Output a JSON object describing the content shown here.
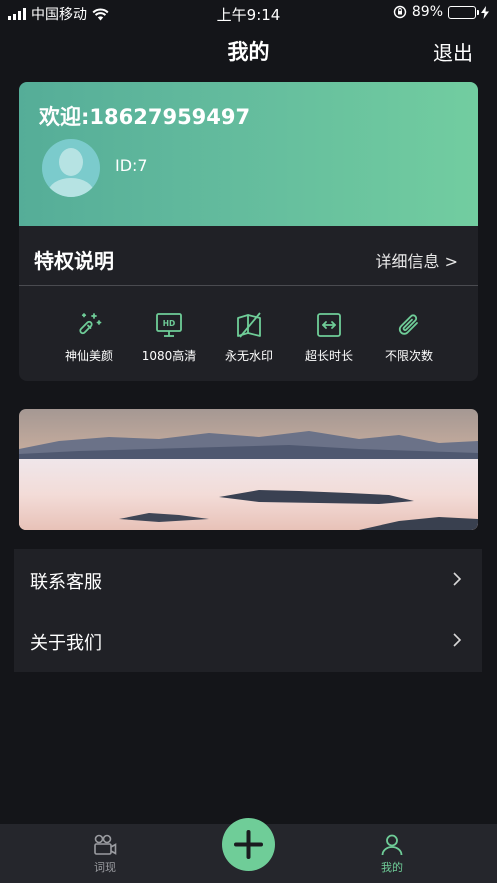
{
  "status_bar": {
    "carrier": "中国移动",
    "time": "上午9:14",
    "battery_text": "89%",
    "battery_level": 0.89
  },
  "nav": {
    "title": "我的",
    "logout_label": "退出"
  },
  "user": {
    "welcome_text": "欢迎:18627959497",
    "id_text": "ID:7"
  },
  "privileges": {
    "title": "特权说明",
    "more_label": "详细信息 >",
    "items": [
      {
        "icon": "magic-wand-icon",
        "label": "神仙美颜"
      },
      {
        "icon": "hd-monitor-icon",
        "label": "1080高清"
      },
      {
        "icon": "no-watermark-icon",
        "label": "永无水印"
      },
      {
        "icon": "expand-time-icon",
        "label": "超长时长"
      },
      {
        "icon": "paperclip-icon",
        "label": "不限次数"
      }
    ]
  },
  "menu": {
    "items": [
      {
        "label": "联系客服"
      },
      {
        "label": "关于我们"
      }
    ]
  },
  "tabbar": {
    "tabs": [
      {
        "label": "词现",
        "icon": "camera-people-icon",
        "active": false
      },
      {
        "label": "我的",
        "icon": "person-icon",
        "active": true
      }
    ],
    "fab_icon": "plus-icon"
  },
  "colors": {
    "accent": "#6fcd98",
    "background": "#141519",
    "card": "#202126",
    "gradient_start": "#55ad98",
    "gradient_end": "#72cda0"
  }
}
